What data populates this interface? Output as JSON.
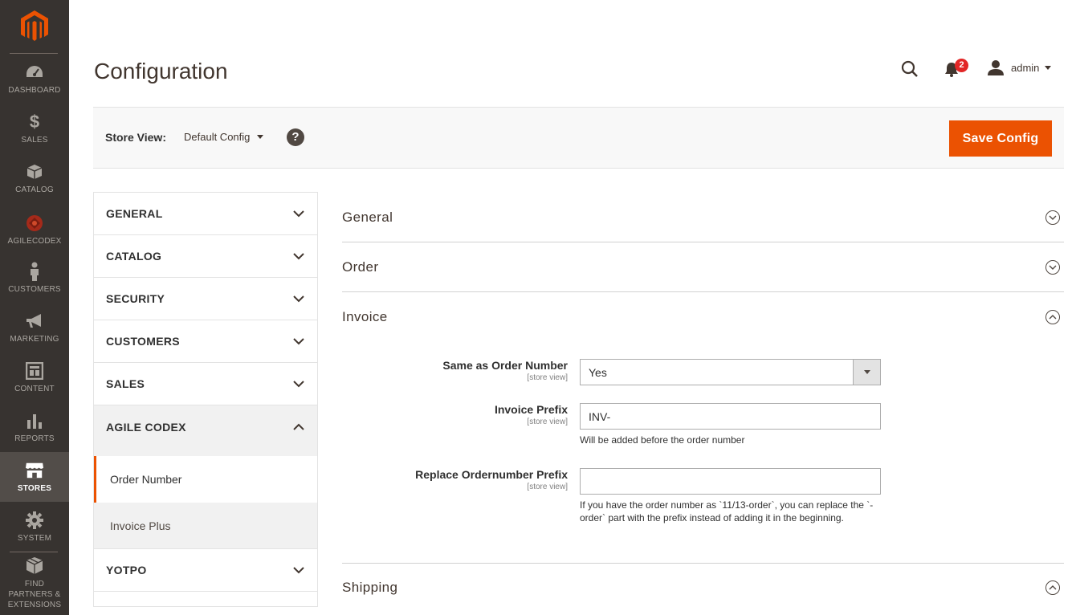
{
  "nav": {
    "items": [
      {
        "label": "DASHBOARD",
        "icon": "dashboard-icon"
      },
      {
        "label": "SALES",
        "icon": "dollar-icon"
      },
      {
        "label": "CATALOG",
        "icon": "box-icon"
      },
      {
        "label": "AGILECODEX",
        "icon": "agilecodex-icon"
      },
      {
        "label": "CUSTOMERS",
        "icon": "person-icon"
      },
      {
        "label": "MARKETING",
        "icon": "megaphone-icon"
      },
      {
        "label": "CONTENT",
        "icon": "layout-icon"
      },
      {
        "label": "REPORTS",
        "icon": "bar-chart-icon"
      },
      {
        "label": "STORES",
        "icon": "store-icon"
      },
      {
        "label": "SYSTEM",
        "icon": "gear-icon"
      },
      {
        "label": "FIND PARTNERS & EXTENSIONS",
        "icon": "boxes-icon"
      }
    ],
    "active": "STORES"
  },
  "header": {
    "title": "Configuration",
    "notifications_count": "2",
    "user_name": "admin"
  },
  "store_view": {
    "label": "Store View:",
    "value": "Default Config",
    "save_label": "Save Config"
  },
  "tabs": {
    "general": "GENERAL",
    "catalog": "CATALOG",
    "security": "SECURITY",
    "customers": "CUSTOMERS",
    "sales": "SALES",
    "agile_codex": "AGILE CODEX",
    "agile_items": [
      "Order Number",
      "Invoice Plus"
    ],
    "yotpo": "YOTPO"
  },
  "sections": {
    "general": "General",
    "order": "Order",
    "invoice": "Invoice",
    "shipping": "Shipping"
  },
  "invoice_fields": {
    "same_as_order": {
      "label": "Same as Order Number",
      "scope": "[store view]",
      "value": "Yes"
    },
    "prefix": {
      "label": "Invoice Prefix",
      "scope": "[store view]",
      "value": "INV-",
      "note": "Will be added before the order number"
    },
    "replace_prefix": {
      "label": "Replace Ordernumber Prefix",
      "scope": "[store view]",
      "value": "",
      "note": "If you have the order number as `11/13-order`, you can replace the `-order` part with the prefix instead of adding it in the beginning."
    }
  },
  "colors": {
    "nav_bg": "#373330",
    "accent": "#eb5202",
    "badge": "#e22626"
  }
}
